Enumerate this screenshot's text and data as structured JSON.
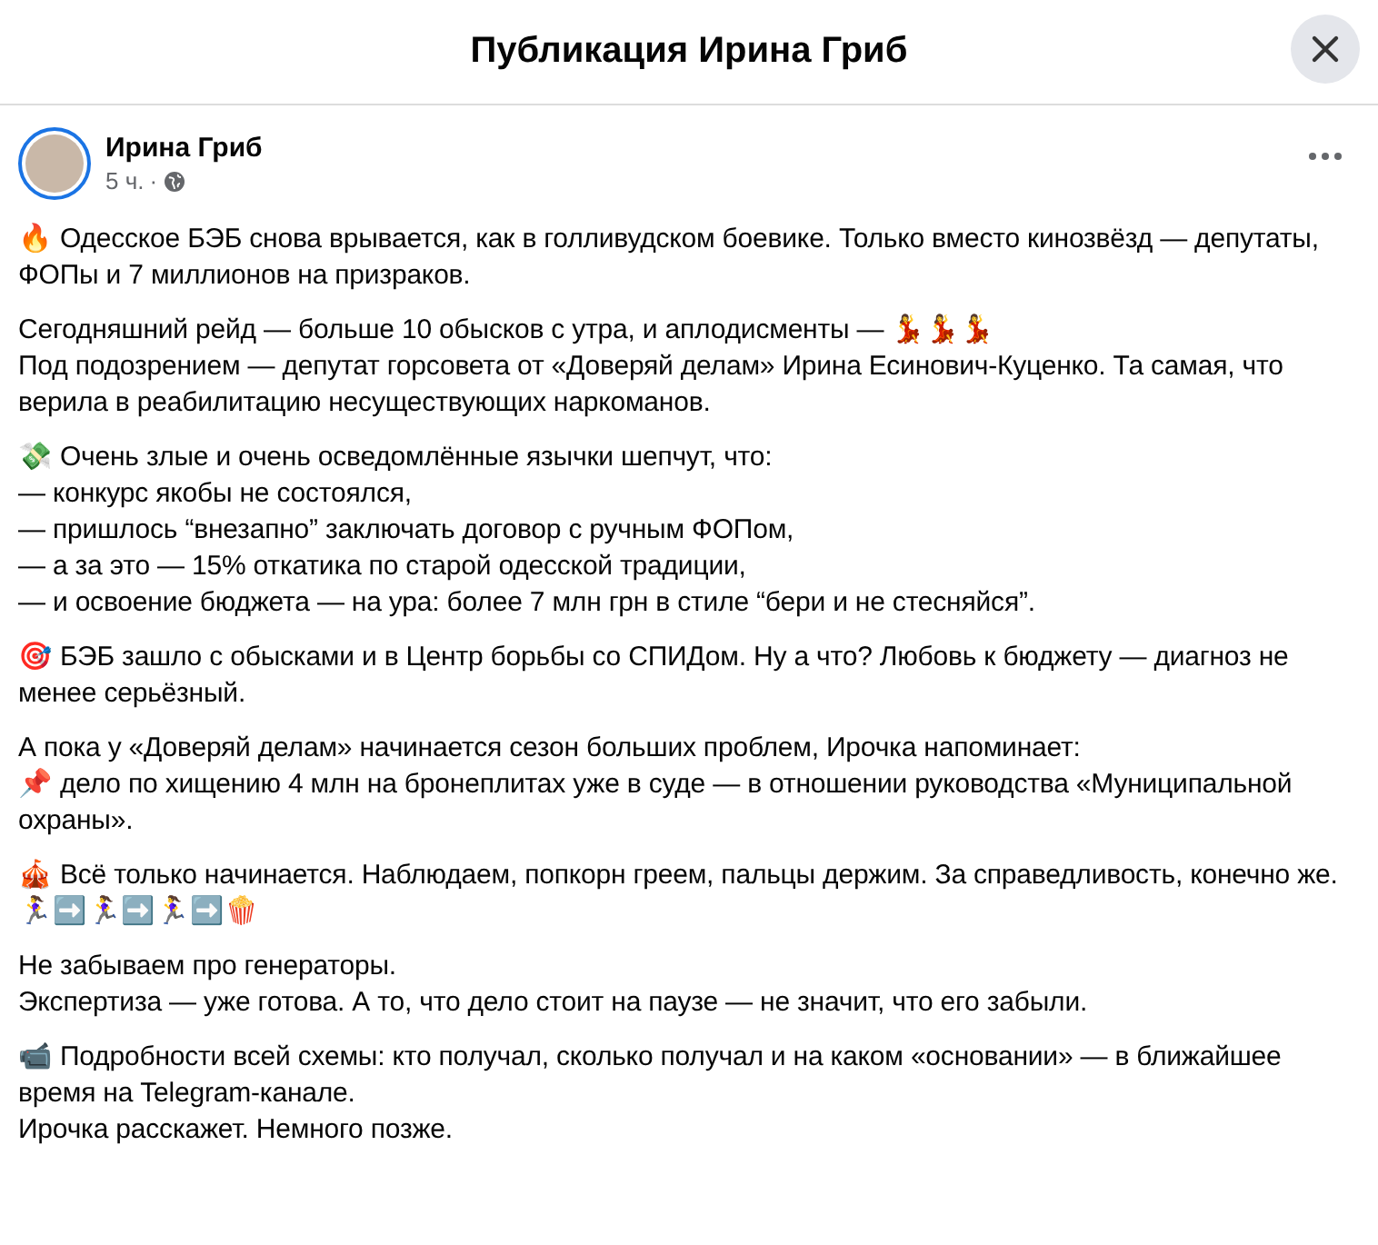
{
  "dialog": {
    "title": "Публикация Ирина Гриб"
  },
  "post": {
    "author": "Ирина Гриб",
    "time": "5 ч.",
    "separator": "·",
    "paragraphs": [
      {
        "lines": [
          "🔥 Одесское БЭБ снова врывается, как в голливудском боевике. Только вместо кинозвёзд — депутаты, ФОПы и 7 миллионов на призраков."
        ]
      },
      {
        "lines": [
          "Сегодняшний рейд — больше 10 обысков с утра, и аплодисменты — 💃💃💃",
          "Под подозрением — депутат горсовета от «Доверяй делам» Ирина Есинович-Куценко. Та самая, что верила в реабилитацию несуществующих наркоманов."
        ]
      },
      {
        "lines": [
          "💸 Очень злые и очень осведомлённые язычки шепчут, что:",
          "— конкурс якобы не состоялся,",
          "— пришлось “внезапно” заключать договор с ручным ФОПом,",
          "— а за это — 15% откатика по старой одесской традиции,",
          "— и освоение бюджета — на ура: более 7 млн грн в стиле “бери и не стесняйся”."
        ]
      },
      {
        "lines": [
          "🎯 БЭБ зашло с обысками и в Центр борьбы со СПИДом. Ну а что? Любовь к бюджету — диагноз не менее серьёзный."
        ]
      },
      {
        "lines": [
          "А пока у «Доверяй делам» начинается сезон больших проблем, Ирочка напоминает:",
          "📌 дело по хищению 4 млн на бронеплитах уже в суде — в отношении руководства «Муниципальной охраны»."
        ]
      },
      {
        "lines": [
          "🎪 Всё только начинается. Наблюдаем, попкорн греем, пальцы держим. За справедливость, конечно же.",
          "🏃‍♀️➡️🏃‍♀️➡️🏃‍♀️➡️🍿"
        ]
      },
      {
        "lines": [
          "Не забываем про генераторы.",
          "Экспертиза — уже готова. А то, что дело стоит на паузе — не значит, что его забыли."
        ]
      },
      {
        "lines": [
          "📹 Подробности всей схемы: кто получал, сколько получал и на каком «основании» — в ближайшее время на Telegram-канале.",
          "Ирочка расскажет. Немного позже."
        ]
      }
    ]
  }
}
